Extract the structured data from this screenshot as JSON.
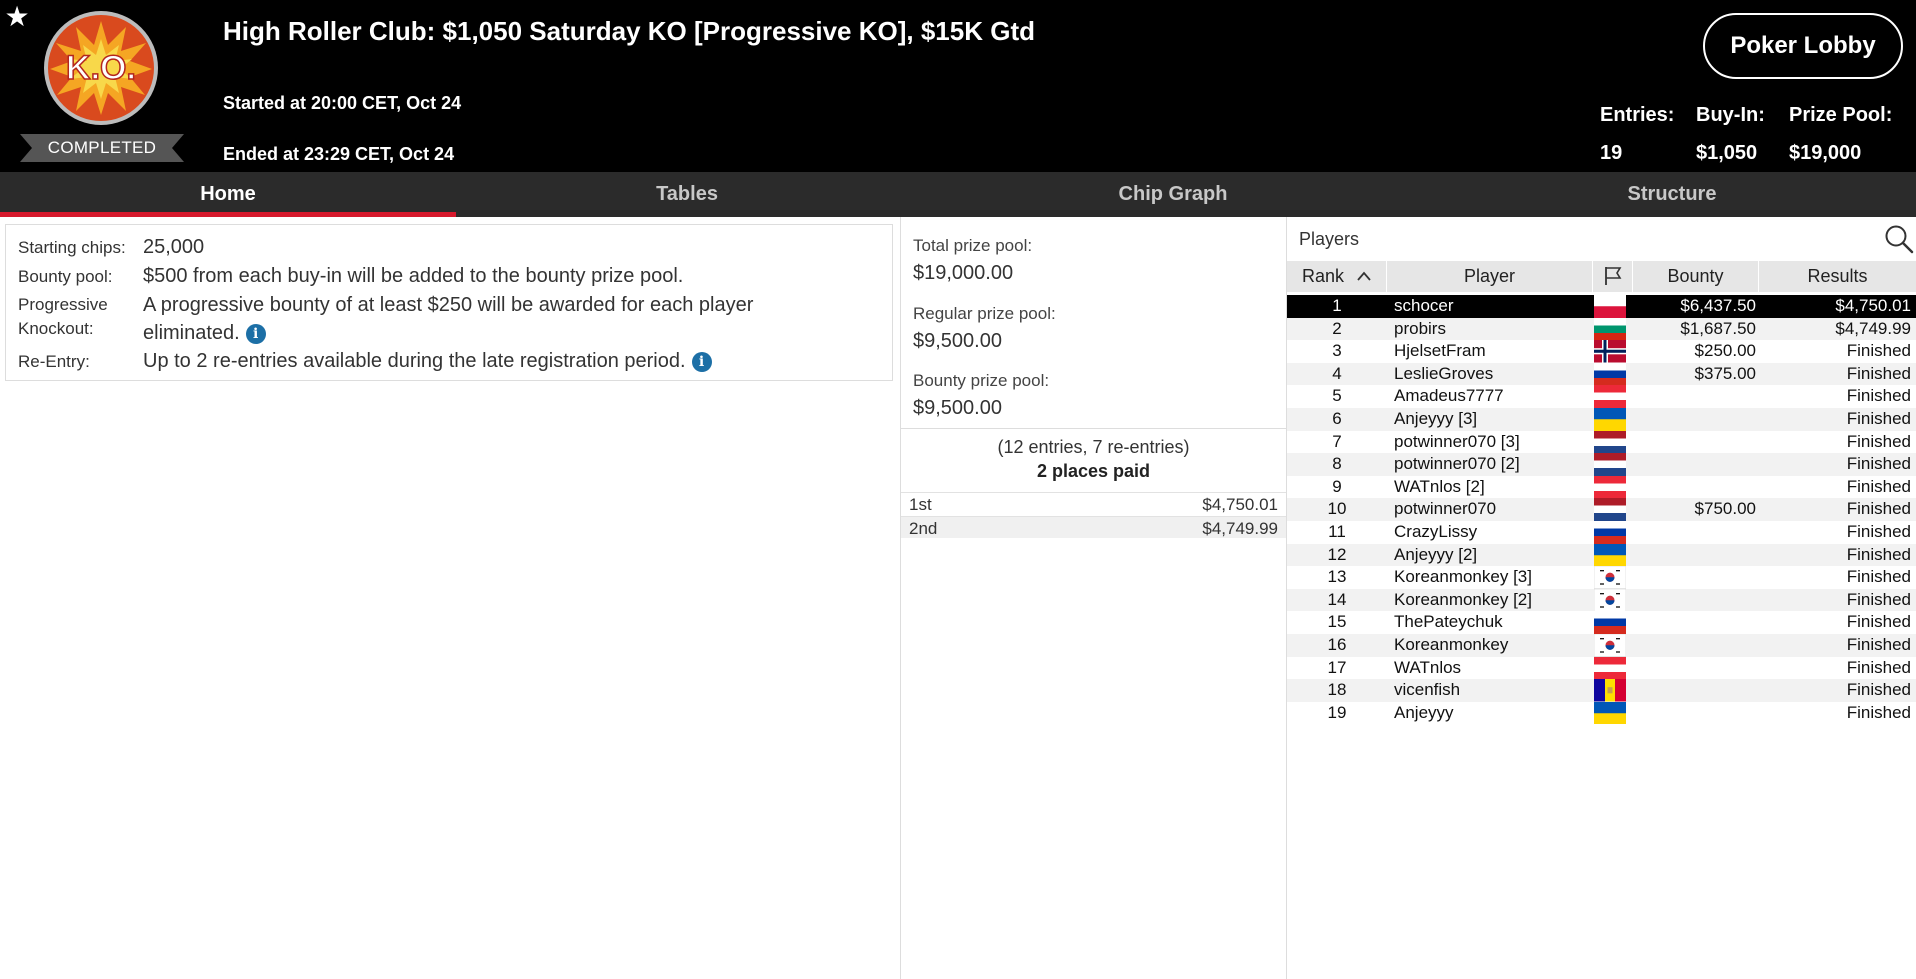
{
  "header": {
    "logo_text": "K.O.",
    "status": "COMPLETED",
    "title": "High Roller Club: $1,050 Saturday KO [Progressive KO], $15K Gtd",
    "started": "Started at 20:00 CET, Oct 24",
    "ended": "Ended at 23:29 CET, Oct 24",
    "lobby_button": "Poker Lobby",
    "stats": [
      {
        "label": "Entries:",
        "value": "19"
      },
      {
        "label": "Buy-In:",
        "value": "$1,050"
      },
      {
        "label": "Prize Pool:",
        "value": "$19,000"
      }
    ]
  },
  "tabs": [
    {
      "label": "Home",
      "active": true
    },
    {
      "label": "Tables",
      "active": false
    },
    {
      "label": "Chip Graph",
      "active": false
    },
    {
      "label": "Structure",
      "active": false
    }
  ],
  "info": {
    "starting_chips_label": "Starting chips:",
    "starting_chips_value": "25,000",
    "bounty_pool_label": "Bounty pool:",
    "bounty_pool_value": "$500 from each buy-in will be added to the bounty prize pool.",
    "progressive_label_1": "Progressive",
    "progressive_label_2": "Knockout:",
    "progressive_value_1": "A progressive bounty of at least $250 will be awarded for each player",
    "progressive_value_2": "eliminated.",
    "reentry_label": "Re-Entry:",
    "reentry_value": "Up to 2 re-entries available during the late registration period."
  },
  "prize": {
    "total_label": "Total prize pool:",
    "total_value": "$19,000.00",
    "regular_label": "Regular prize pool:",
    "regular_value": "$9,500.00",
    "bounty_label": "Bounty prize pool:",
    "bounty_value": "$9,500.00",
    "entries_info": "(12 entries, 7 re-entries)",
    "places_paid": "2 places paid",
    "payouts": [
      {
        "place": "1st",
        "amount": "$4,750.01"
      },
      {
        "place": "2nd",
        "amount": "$4,749.99"
      }
    ]
  },
  "players": {
    "title": "Players",
    "columns": {
      "rank": "Rank",
      "player": "Player",
      "bounty": "Bounty",
      "results": "Results"
    },
    "sort_icon": "chevron-up-icon",
    "rows": [
      {
        "rank": "1",
        "name": "schocer",
        "flag": "poland",
        "bounty": "$6,437.50",
        "result": "$4,750.01"
      },
      {
        "rank": "2",
        "name": "probirs",
        "flag": "bulgaria",
        "bounty": "$1,687.50",
        "result": "$4,749.99"
      },
      {
        "rank": "3",
        "name": "HjelsetFram",
        "flag": "norway",
        "bounty": "$250.00",
        "result": "Finished"
      },
      {
        "rank": "4",
        "name": "LeslieGroves",
        "flag": "russia",
        "bounty": "$375.00",
        "result": "Finished"
      },
      {
        "rank": "5",
        "name": "Amadeus7777",
        "flag": "austria",
        "bounty": "",
        "result": "Finished"
      },
      {
        "rank": "6",
        "name": "Anjeyyy [3]",
        "flag": "ukraine",
        "bounty": "",
        "result": "Finished"
      },
      {
        "rank": "7",
        "name": "potwinner070 [3]",
        "flag": "netherlands",
        "bounty": "",
        "result": "Finished"
      },
      {
        "rank": "8",
        "name": "potwinner070 [2]",
        "flag": "netherlands",
        "bounty": "",
        "result": "Finished"
      },
      {
        "rank": "9",
        "name": "WATnlos [2]",
        "flag": "austria",
        "bounty": "",
        "result": "Finished"
      },
      {
        "rank": "10",
        "name": "potwinner070",
        "flag": "netherlands",
        "bounty": "$750.00",
        "result": "Finished"
      },
      {
        "rank": "11",
        "name": "CrazyLissy",
        "flag": "russia",
        "bounty": "",
        "result": "Finished"
      },
      {
        "rank": "12",
        "name": "Anjeyyy [2]",
        "flag": "ukraine",
        "bounty": "",
        "result": "Finished"
      },
      {
        "rank": "13",
        "name": "Koreanmonkey [3]",
        "flag": "korea",
        "bounty": "",
        "result": "Finished"
      },
      {
        "rank": "14",
        "name": "Koreanmonkey [2]",
        "flag": "korea",
        "bounty": "",
        "result": "Finished"
      },
      {
        "rank": "15",
        "name": "ThePateychuk",
        "flag": "russia",
        "bounty": "",
        "result": "Finished"
      },
      {
        "rank": "16",
        "name": "Koreanmonkey",
        "flag": "korea",
        "bounty": "",
        "result": "Finished"
      },
      {
        "rank": "17",
        "name": "WATnlos",
        "flag": "austria",
        "bounty": "",
        "result": "Finished"
      },
      {
        "rank": "18",
        "name": "vicenfish",
        "flag": "andorra",
        "bounty": "",
        "result": "Finished"
      },
      {
        "rank": "19",
        "name": "Anjeyyy",
        "flag": "ukraine",
        "bounty": "",
        "result": "Finished"
      }
    ]
  },
  "colors": {
    "accent": "#d7192d",
    "info_icon": "#1c6fa6",
    "header_bg": "#000000",
    "tabbar_bg": "#2b2b2b"
  }
}
